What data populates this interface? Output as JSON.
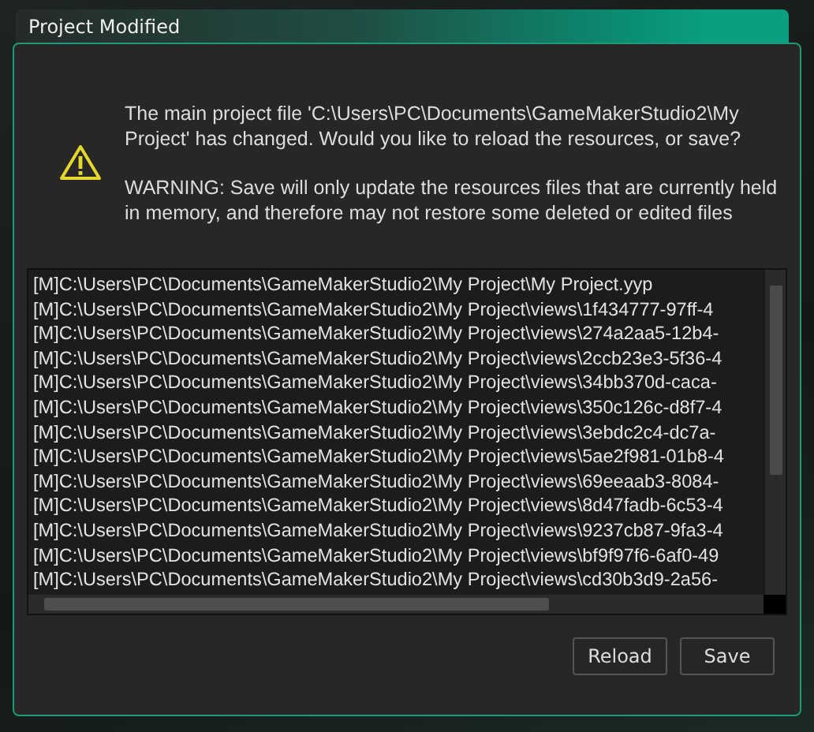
{
  "window": {
    "title": "Project Modified"
  },
  "message": {
    "text": "The main project file 'C:\\Users\\PC\\Documents\\GameMakerStudio2\\My Project' has changed. Would you like to reload the resources, or save?",
    "warning": "WARNING: Save will only update the resources files that are currently held in memory, and therefore may not restore some deleted or edited files"
  },
  "files": [
    "[M]C:\\Users\\PC\\Documents\\GameMakerStudio2\\My Project\\My Project.yyp",
    "[M]C:\\Users\\PC\\Documents\\GameMakerStudio2\\My Project\\views\\1f434777-97ff-4",
    "[M]C:\\Users\\PC\\Documents\\GameMakerStudio2\\My Project\\views\\274a2aa5-12b4-",
    "[M]C:\\Users\\PC\\Documents\\GameMakerStudio2\\My Project\\views\\2ccb23e3-5f36-4",
    "[M]C:\\Users\\PC\\Documents\\GameMakerStudio2\\My Project\\views\\34bb370d-caca-",
    "[M]C:\\Users\\PC\\Documents\\GameMakerStudio2\\My Project\\views\\350c126c-d8f7-4",
    "[M]C:\\Users\\PC\\Documents\\GameMakerStudio2\\My Project\\views\\3ebdc2c4-dc7a-",
    "[M]C:\\Users\\PC\\Documents\\GameMakerStudio2\\My Project\\views\\5ae2f981-01b8-4",
    "[M]C:\\Users\\PC\\Documents\\GameMakerStudio2\\My Project\\views\\69eeaab3-8084-",
    "[M]C:\\Users\\PC\\Documents\\GameMakerStudio2\\My Project\\views\\8d47fadb-6c53-4",
    "[M]C:\\Users\\PC\\Documents\\GameMakerStudio2\\My Project\\views\\9237cb87-9fa3-4",
    "[M]C:\\Users\\PC\\Documents\\GameMakerStudio2\\My Project\\views\\bf9f97f6-6af0-49",
    "[M]C:\\Users\\PC\\Documents\\GameMakerStudio2\\My Project\\views\\cd30b3d9-2a56-"
  ],
  "buttons": [
    "Reload",
    "Save"
  ]
}
